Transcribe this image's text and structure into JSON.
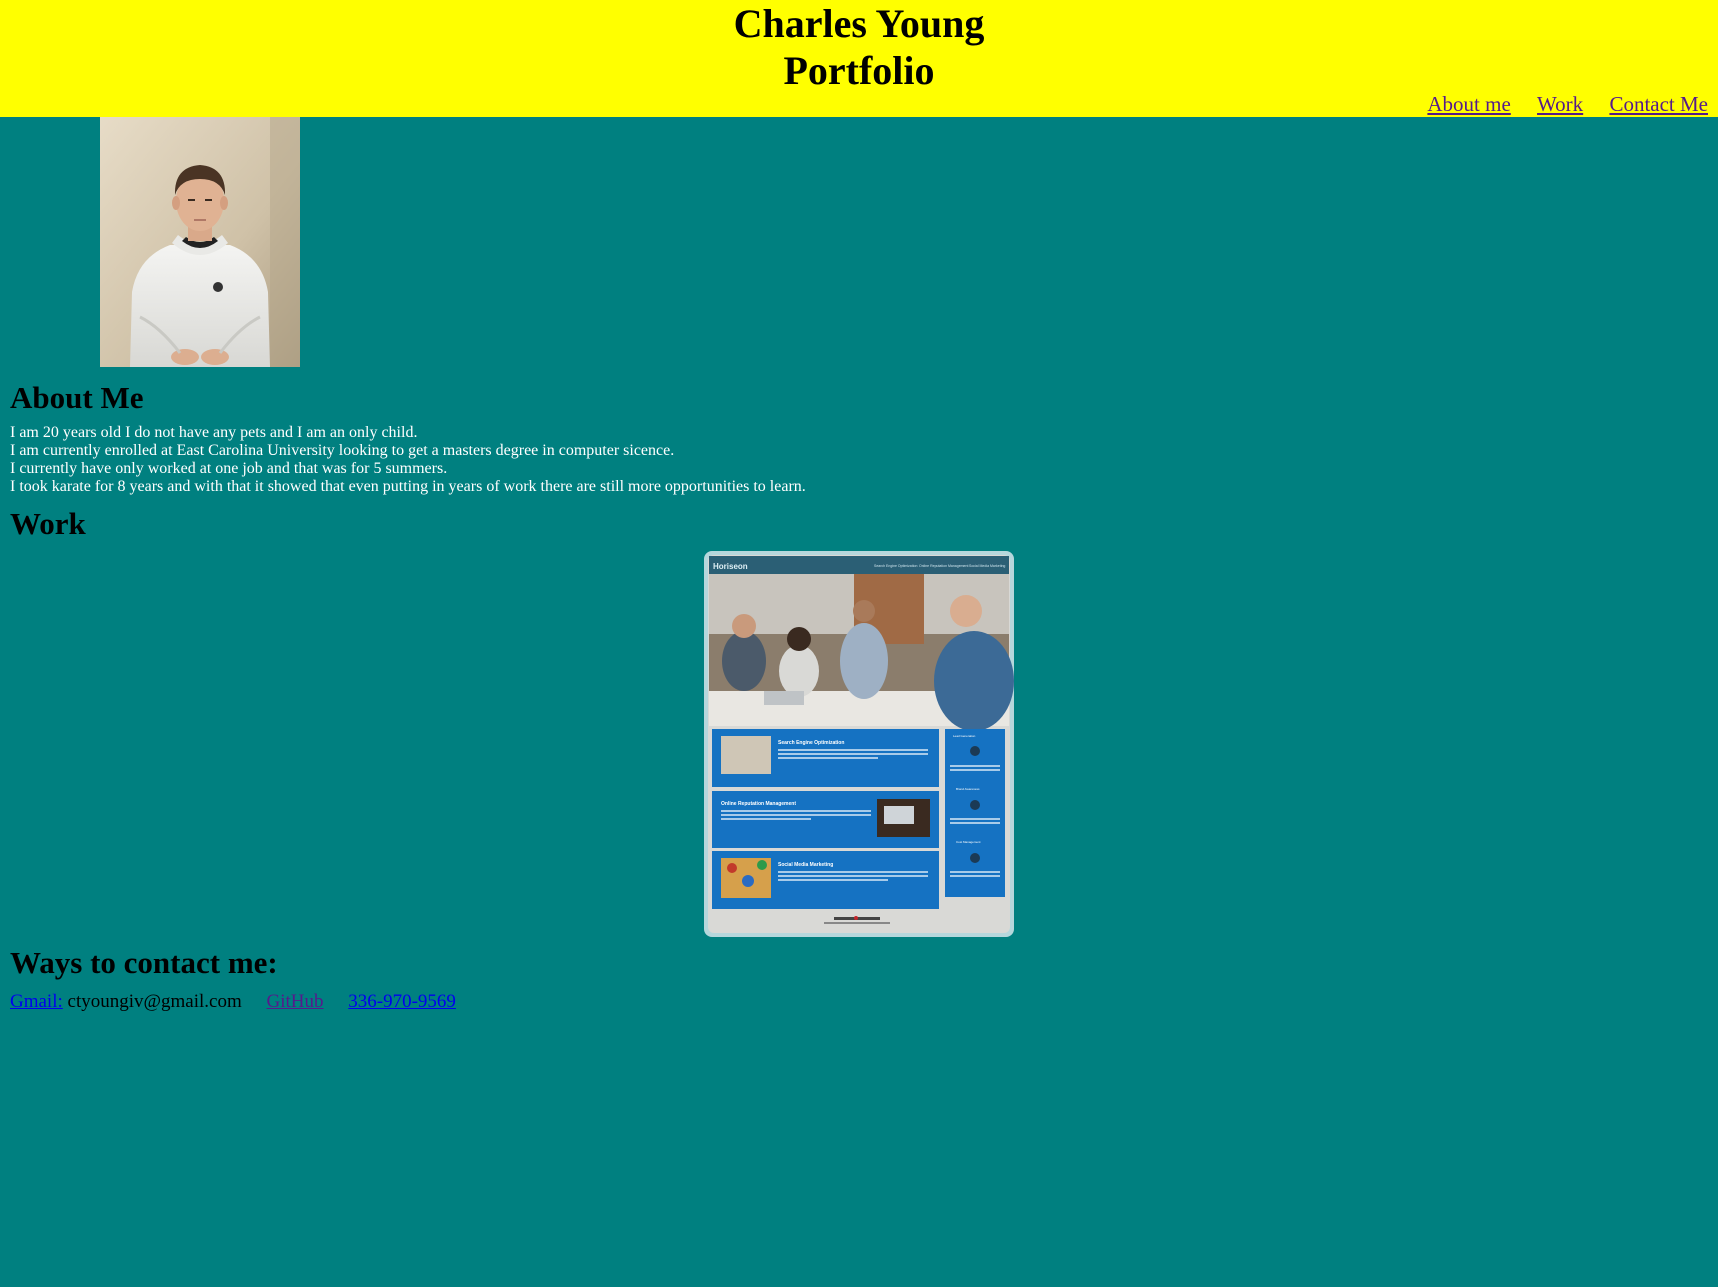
{
  "header": {
    "title_line1": "Charles Young",
    "title_line2": "Portfolio",
    "background_color": "#ffff00"
  },
  "nav": {
    "items": [
      {
        "label": "About me"
      },
      {
        "label": "Work"
      },
      {
        "label": "Contact Me"
      }
    ]
  },
  "portrait": {
    "alt": "Photo of Charles Young"
  },
  "about": {
    "heading": "About Me",
    "lines": [
      "I am 20 years old I do not have any pets and I am an only child.",
      "I am currently enrolled at East Carolina University looking to get a masters degree in computer sicence.",
      "I currently have only worked at one job and that was for 5 summers.",
      "I took karate for 8 years and with that it showed that even putting in years of work there are still more opportunities to learn."
    ]
  },
  "work": {
    "heading": "Work",
    "project": {
      "brand": "Horiseon",
      "nav": [
        "Search Engine Optimization",
        "Online Reputation Management",
        "Social Media Marketing"
      ],
      "sections": [
        "Search Engine Optimization",
        "Online Reputation Management",
        "Social Media Marketing"
      ],
      "sidebar": [
        "Lead Generation",
        "Brand Awareness",
        "Cost Management"
      ]
    }
  },
  "contact": {
    "heading": "Ways to contact me:",
    "gmail_label": "Gmail:",
    "email": "ctyoungiv@gmail.com",
    "github_label": "GitHub",
    "phone": "336-970-9569"
  },
  "colors": {
    "page_background": "#008080",
    "link": "#0000ee",
    "visited_link": "#551a8b"
  }
}
